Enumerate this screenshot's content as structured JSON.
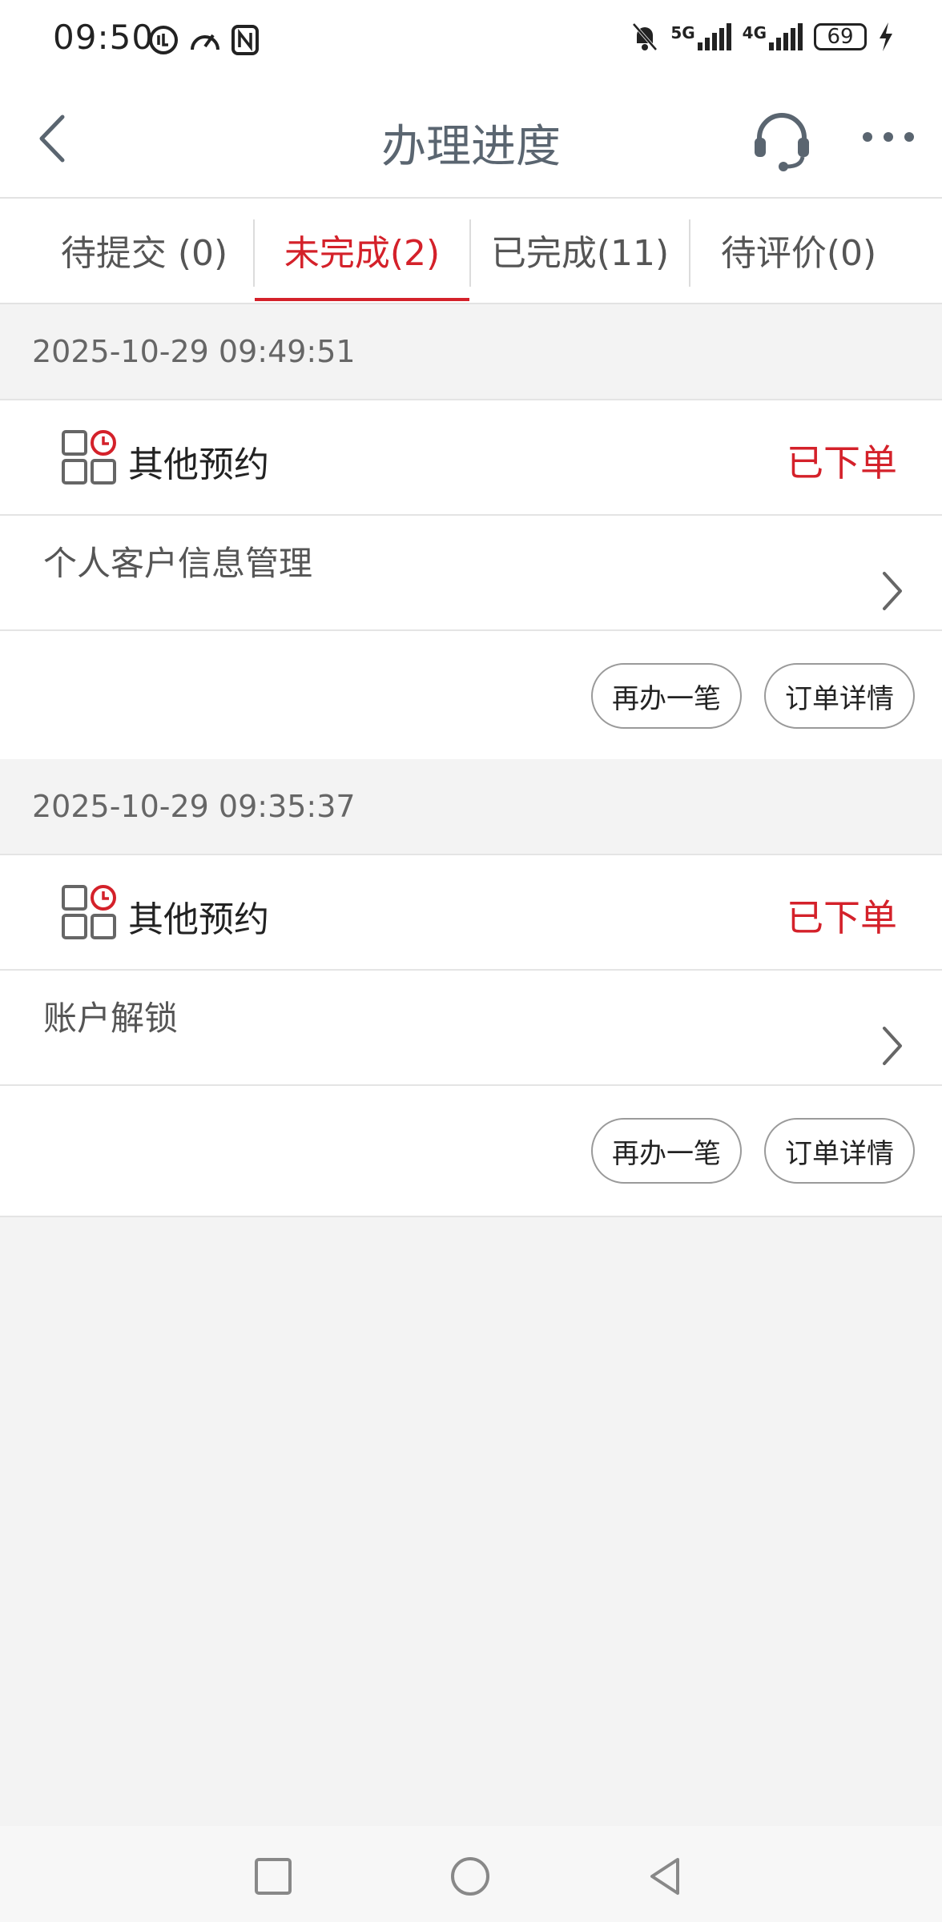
{
  "status_bar": {
    "time": "09:50",
    "signal_5g": "5G",
    "signal_4g": "4G",
    "battery": "69"
  },
  "nav": {
    "title": "办理进度"
  },
  "tabs": [
    {
      "label": "待提交 (0)",
      "active": false
    },
    {
      "label": "未完成(2)",
      "active": true
    },
    {
      "label": "已完成(11)",
      "active": false
    },
    {
      "label": "待评价(0)",
      "active": false
    }
  ],
  "orders": [
    {
      "time": "2025-10-29 09:49:51",
      "service": "其他预约",
      "status": "已下单",
      "business": "个人客户信息管理",
      "again_label": "再办一笔",
      "detail_label": "订单详情"
    },
    {
      "time": "2025-10-29 09:35:37",
      "service": "其他预约",
      "status": "已下单",
      "business": "账户解锁",
      "again_label": "再办一笔",
      "detail_label": "订单详情"
    }
  ],
  "colors": {
    "accent": "#d4212a",
    "background": "#f3f3f3"
  }
}
